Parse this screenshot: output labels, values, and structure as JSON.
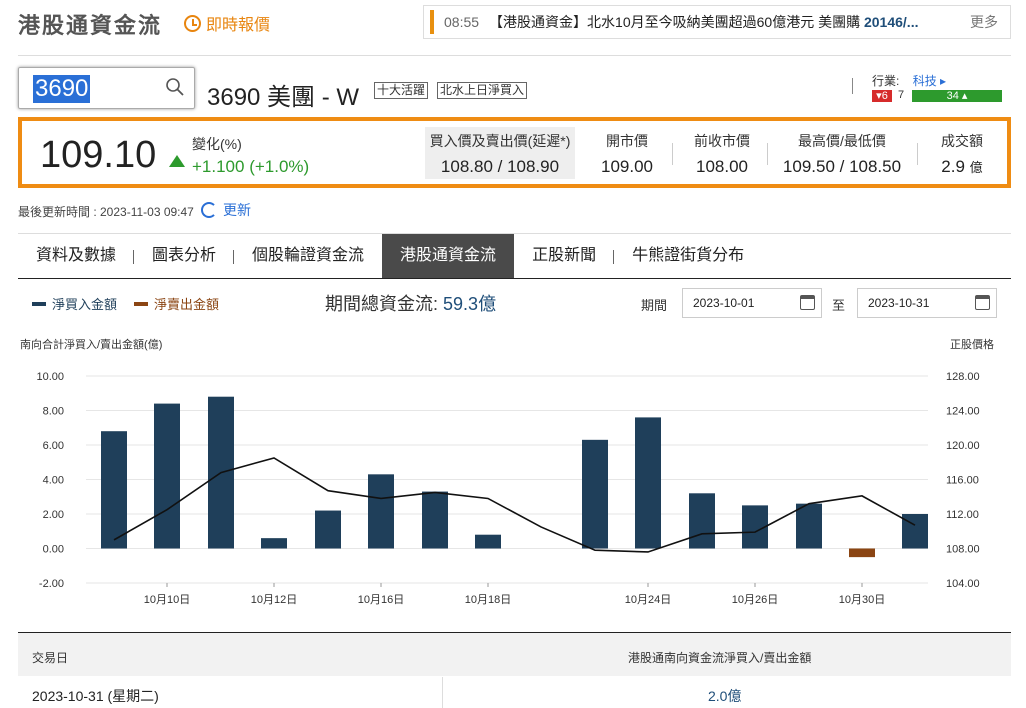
{
  "header": {
    "title": "港股通資金流",
    "realtime_label": "即時報價",
    "ticker_time": "08:55",
    "ticker_text_pre": "【港股通資金】北水10月至今吸納美團超過60億港元 美團購 ",
    "ticker_text_bold": "20146/...",
    "ticker_more": "更多"
  },
  "search": {
    "value": "3690"
  },
  "stock": {
    "name": "3690 美團 - W",
    "tags": [
      "十大活躍",
      "北水上日淨買入"
    ]
  },
  "industry": {
    "label": "行業:",
    "link": "科技",
    "down_count": "6",
    "flat_count": "7",
    "up_count": "34"
  },
  "quote": {
    "price": "109.10",
    "change_label": "變化(%)",
    "change_value": "+1.100 (+1.0%)",
    "bid_ask_label": "買入價及賣出價(延遲*)",
    "bid_ask_value": "108.80 / 108.90",
    "open_label": "開市價",
    "open_value": "109.00",
    "prev_close_label": "前收市價",
    "prev_close_value": "108.00",
    "high_low_label": "最高價/最低價",
    "high_low_value": "109.50 / 108.50",
    "turnover_label": "成交額",
    "turnover_value": "2.9",
    "turnover_unit": "億"
  },
  "update": {
    "text": "最後更新時間 : 2023-11-03 09:47",
    "refresh_label": "更新"
  },
  "tabs": [
    "資料及數據",
    "圖表分析",
    "個股輪證資金流",
    "港股通資金流",
    "正股新聞",
    "牛熊證街貨分布"
  ],
  "legend": {
    "inflow": "淨買入金額",
    "outflow": "淨賣出金額"
  },
  "colors": {
    "inflow": "#1f3f5a",
    "outflow": "#8b4513",
    "accent": "#ef8c13",
    "up": "#2d9a2d",
    "down": "#d62b2b"
  },
  "period": {
    "total_label": "期間總資金流:",
    "total_value": "59.3億",
    "period_label": "期間",
    "start": "2023-10-01",
    "to_label": "至",
    "end": "2023-10-31"
  },
  "chart_data": {
    "type": "bar",
    "ylabel": "南向合計淨買入/賣出金額(億)",
    "y2label": "正股價格",
    "ylim": [
      -2,
      10
    ],
    "y2lim": [
      104,
      128
    ],
    "yticks": [
      "10.00",
      "8.00",
      "6.00",
      "4.00",
      "2.00",
      "0.00",
      "-2.00"
    ],
    "y2ticks": [
      "128.00",
      "124.00",
      "120.00",
      "116.00",
      "112.00",
      "108.00",
      "104.00"
    ],
    "xticks": [
      "10月10日",
      "10月12日",
      "10月16日",
      "10月18日",
      "10月24日",
      "10月26日",
      "10月30日"
    ],
    "categories": [
      "10-09",
      "10-10",
      "10-11",
      "10-12",
      "10-13",
      "10-16",
      "10-17",
      "10-18",
      "10-19",
      "10-20",
      "10-24",
      "10-25",
      "10-26",
      "10-27",
      "10-30",
      "10-31"
    ],
    "values": [
      6.8,
      8.4,
      8.8,
      0.6,
      2.2,
      4.3,
      3.3,
      0.8,
      null,
      6.3,
      7.6,
      3.2,
      2.5,
      2.6,
      -0.5,
      2.0
    ],
    "price": [
      109.0,
      112.5,
      116.8,
      118.5,
      114.7,
      113.8,
      114.5,
      113.8,
      110.5,
      107.8,
      107.6,
      109.7,
      109.9,
      113.2,
      114.1,
      110.7
    ],
    "grid": true,
    "legend": "top-left"
  },
  "table": {
    "header_date": "交易日",
    "header_flow": "港股通南向資金流淨買入/賣出金額",
    "rows": [
      {
        "date": "2023-10-31 (星期二)",
        "flow": "2.0億"
      }
    ]
  }
}
